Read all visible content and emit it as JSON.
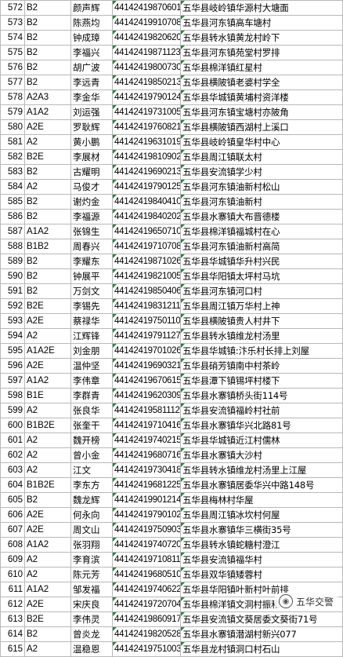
{
  "rows": [
    {
      "no": "572",
      "cls": "B2",
      "name": "颜声辉",
      "id": "44142419870601:",
      "addr": "五华县岐岭镇华源村大塘面"
    },
    {
      "no": "573",
      "cls": "B2",
      "name": "陈燕均",
      "id": "44142419910708",
      "addr": "五华县河东镇高车塘村"
    },
    {
      "no": "574",
      "cls": "B2",
      "name": "钟成璋",
      "id": "44142419820620",
      "addr": "五华县转水镇黄龙村岭下"
    },
    {
      "no": "575",
      "cls": "B2",
      "name": "李福兴",
      "id": "44142419871123",
      "addr": "五华县河东镇苑堂村罗排"
    },
    {
      "no": "576",
      "cls": "B2",
      "name": "胡广波",
      "id": "44142419800730",
      "addr": "五华县棉洋镇红星村"
    },
    {
      "no": "577",
      "cls": "B2",
      "name": "李远青",
      "id": "44142419850213",
      "addr": "五华县横陂镇老婆村学全"
    },
    {
      "no": "578",
      "cls": "A2A3",
      "name": "李金华",
      "id": "44142419790124",
      "addr": "五华县华城镇黄埔村资洋楼"
    },
    {
      "no": "579",
      "cls": "A1A2",
      "name": "刘运强",
      "id": "44142419731005",
      "addr": "五华县河东镇宝塘村亦陂角"
    },
    {
      "no": "580",
      "cls": "A2E",
      "name": "罗耿辉",
      "id": "44142419760821",
      "addr": "五华县横陂镇西湖村上溪口"
    },
    {
      "no": "581",
      "cls": "A2",
      "name": "黄小鹏",
      "id": "44142419631019",
      "addr": "五华县岐岭镇皇华村中心"
    },
    {
      "no": "582",
      "cls": "B2E",
      "name": "李展材",
      "id": "44142419810902",
      "addr": "五华县周江镇联太村"
    },
    {
      "no": "583",
      "cls": "B2",
      "name": "古耀明",
      "id": "44142419690213",
      "addr": "五华县安流镇学少村"
    },
    {
      "no": "584",
      "cls": "A2",
      "name": "马俊才",
      "id": "44142419790125",
      "addr": "五华县河东镇油新村松山"
    },
    {
      "no": "585",
      "cls": "B2",
      "name": "谢灼金",
      "id": "44142419840410",
      "addr": "五华县河东镇油新村"
    },
    {
      "no": "586",
      "cls": "B2",
      "name": "李福源",
      "id": "44142419840202",
      "addr": "五华县水寨镇大布晋德楼"
    },
    {
      "no": "587",
      "cls": "A1A2",
      "name": "张锦生",
      "id": "44142419650710",
      "addr": "五华县棉洋镇福城村在心"
    },
    {
      "no": "588",
      "cls": "B1B2",
      "name": "周春兴",
      "id": "44142419710708",
      "addr": "五华县河东镇油新村高简"
    },
    {
      "no": "589",
      "cls": "B2",
      "name": "李耀东",
      "id": "44142419871026",
      "addr": "五华县华城镇华升村兴民"
    },
    {
      "no": "590",
      "cls": "B2",
      "name": "钟展平",
      "id": "44142419821005",
      "addr": "五华县华阳镇太坪村马坑"
    },
    {
      "no": "591",
      "cls": "B2",
      "name": "万剑文",
      "id": "44142419850406",
      "addr": "五华县河东镇河口村"
    },
    {
      "no": "592",
      "cls": "B2E",
      "name": "李锡先",
      "id": "44142419831211",
      "addr": "五华县周江镇万华村上神"
    },
    {
      "no": "593",
      "cls": "A2E",
      "name": "蔡禄华",
      "id": "44142419750110",
      "addr": "五华县横陂镇贵人村井下"
    },
    {
      "no": "594",
      "cls": "A2",
      "name": "江辉锋",
      "id": "44142419791127",
      "addr": "五华县转水镇维龙村汤里"
    },
    {
      "no": "595",
      "cls": "A1A2E",
      "name": "刘金朋",
      "id": "44142419701026",
      "addr": "五华县华城镇:汴乐村长排上刘屋"
    },
    {
      "no": "596",
      "cls": "A2E",
      "name": "温仲坚",
      "id": "44142419690321",
      "addr": "五华县硝芳镇南中村茶岭"
    },
    {
      "no": "597",
      "cls": "A1A2",
      "name": "李伟章",
      "id": "44142419670615",
      "addr": "五华县潭下镇锡坪村楼下"
    },
    {
      "no": "598",
      "cls": "B1E",
      "name": "李群青",
      "id": "44142419620309",
      "addr": "五华县水寨镇桥头街114号"
    },
    {
      "no": "599",
      "cls": "A2",
      "name": "张良华",
      "id": "44142419581112",
      "addr": "五华县安流镇福岭村社前"
    },
    {
      "no": "600",
      "cls": "B1B2E",
      "name": "张奎干",
      "id": "44142419710416",
      "addr": "五华县水寨镇华兴北路81号"
    },
    {
      "no": "601",
      "cls": "A2",
      "name": "魏开榜",
      "id": "44142419740215",
      "addr": "五华县华城镇近江村儒林"
    },
    {
      "no": "602",
      "cls": "A2",
      "name": "曾小金",
      "id": "44142419680716",
      "addr": "五华县水寨镇大沙村"
    },
    {
      "no": "603",
      "cls": "A2",
      "name": "江文",
      "id": "44142419730418",
      "addr": "五华县转水镇维龙村汤里上江屋"
    },
    {
      "no": "604",
      "cls": "B1B2E",
      "name": "李东方",
      "id": "44142419681225",
      "addr": "五华县水寨镇居委华兴中路148号"
    },
    {
      "no": "605",
      "cls": "B2",
      "name": "魏龙辉",
      "id": "44142419901214",
      "addr": "五华县梅林村华屋"
    },
    {
      "no": "606",
      "cls": "A2E",
      "name": "何永向",
      "id": "44142419790102",
      "addr": "五华县周江镇冰坎村何屋"
    },
    {
      "no": "607",
      "cls": "A2E",
      "name": "周文山",
      "id": "44142419750903",
      "addr": "五华县水寨镇华三横街35号"
    },
    {
      "no": "608",
      "cls": "A1A2",
      "name": "张羽翔",
      "id": "44142419740720",
      "addr": "五华县转水镇蛇糖村澄江"
    },
    {
      "no": "609",
      "cls": "A2",
      "name": "李育滨",
      "id": "44142419710811",
      "addr": "五华县安流镇福华村"
    },
    {
      "no": "610",
      "cls": "A2",
      "name": "陈元芳",
      "id": "44142419680510",
      "addr": "五华县双华镇矮蓉村"
    },
    {
      "no": "611",
      "cls": "A1A2",
      "name": "邹发福",
      "id": "44142419740622",
      "addr": "五华县华阳镇叶新村叶前排"
    },
    {
      "no": "612",
      "cls": "A2E",
      "name": "宋庆良",
      "id": "44142419720704",
      "addr": "五华县棉洋镇文洞村振和"
    },
    {
      "no": "613",
      "cls": "B2E",
      "name": "李伟灵",
      "id": "44142419860917",
      "addr": "五华县安流镇文葵居委文葵街71号"
    },
    {
      "no": "614",
      "cls": "B2",
      "name": "曾炎龙",
      "id": "44142419820528",
      "addr": "五华县水寨镇潜湖村新兴077"
    },
    {
      "no": "615",
      "cls": "A2",
      "name": "温稳恩",
      "id": "44142419751003",
      "addr": "五华县龙村镇洞口村石山"
    }
  ],
  "watermark": {
    "text": "五华交警",
    "icon": "chat-bubble-icon"
  },
  "colors": {
    "grid": "#b9b9b9",
    "marker": "#1f8a3a"
  }
}
